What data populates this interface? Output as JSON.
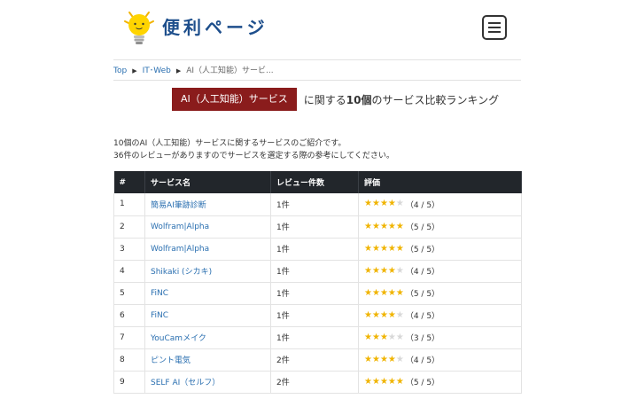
{
  "header": {
    "logo_text": "便利ページ",
    "menu_icon": "hamburger-menu-icon"
  },
  "breadcrumb": {
    "items": [
      "Top",
      "IT･Web"
    ],
    "current": "AI（人工知能）サービ..."
  },
  "heading": {
    "badge": "AI（人工知能）サービス",
    "prefix": "に関する",
    "count": "10個",
    "suffix": "のサービス比較ランキング"
  },
  "intro": {
    "line1": "10個のAI（人工知能）サービスに関するサービスのご紹介です。",
    "line2": "36件のレビューがありますのでサービスを選定する際の参考にしてください。"
  },
  "table": {
    "headers": [
      "#",
      "サービス名",
      "レビュー件数",
      "評価"
    ],
    "rows": [
      {
        "rank": "1",
        "name": "簡易AI筆跡診断",
        "reviews": "1件",
        "rating": "（4 / 5）",
        "stars": 4
      },
      {
        "rank": "2",
        "name": "Wolfram|Alpha",
        "reviews": "1件",
        "rating": "（5 / 5）",
        "stars": 5
      },
      {
        "rank": "3",
        "name": "Wolfram|Alpha",
        "reviews": "1件",
        "rating": "（5 / 5）",
        "stars": 5
      },
      {
        "rank": "4",
        "name": "Shikaki (シカキ)",
        "reviews": "1件",
        "rating": "（4 / 5）",
        "stars": 4
      },
      {
        "rank": "5",
        "name": "FiNC",
        "reviews": "1件",
        "rating": "（5 / 5）",
        "stars": 5
      },
      {
        "rank": "6",
        "name": "FiNC",
        "reviews": "1件",
        "rating": "（4 / 5）",
        "stars": 4
      },
      {
        "rank": "7",
        "name": "YouCamメイク",
        "reviews": "1件",
        "rating": "（3 / 5）",
        "stars": 3
      },
      {
        "rank": "8",
        "name": "ピント電気",
        "reviews": "2件",
        "rating": "（4 / 5）",
        "stars": 4
      },
      {
        "rank": "9",
        "name": "SELF AI（セルフ）",
        "reviews": "2件",
        "rating": "（5 / 5）",
        "stars": 5
      }
    ]
  },
  "colors": {
    "accent": "#1e4f8c",
    "badge": "#8a1c1c",
    "link": "#2a6fb0",
    "table_header": "#22262b",
    "star_on": "#f0b400",
    "star_off": "#d8d8d8"
  }
}
